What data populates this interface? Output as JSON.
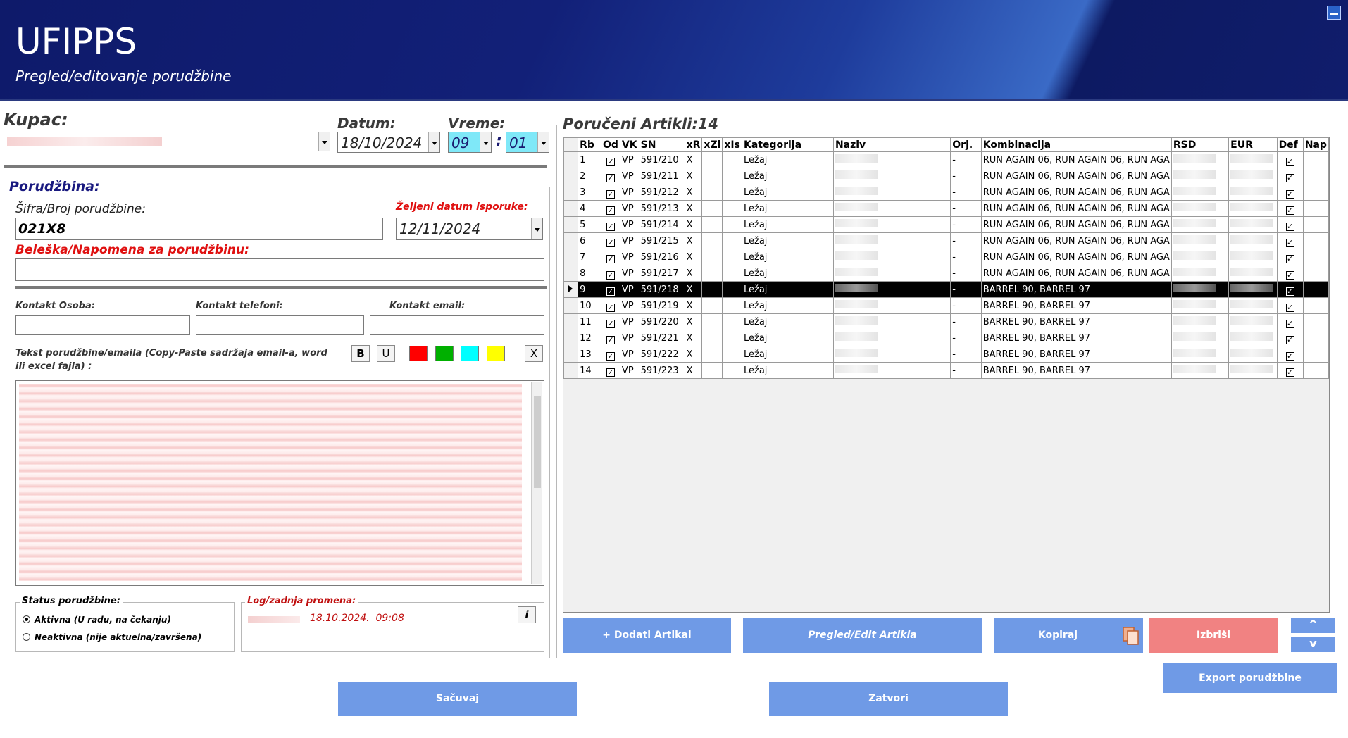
{
  "app": {
    "title": "UFIPPS",
    "subtitle": "Pregled/editovanje porudžbine"
  },
  "customer": {
    "label": "Kupac:"
  },
  "date": {
    "label": "Datum:",
    "value": "18/10/2024"
  },
  "time": {
    "label": "Vreme:",
    "hour": "09",
    "separator": ":",
    "minute": "01"
  },
  "order": {
    "section_label": "Porudžbina:",
    "number_label": "Šifra/Broj porudžbine:",
    "number_value": "021X8",
    "delivery_label": "Željeni datum isporuke:",
    "delivery_value": "12/11/2024",
    "note_label": "Beleška/Napomena za porudžbinu:"
  },
  "contact": {
    "person_label": "Kontakt Osoba:",
    "phones_label": "Kontakt telefoni:",
    "email_label": "Kontakt email:"
  },
  "email_text": {
    "label": "Tekst porudžbine/emaila (Copy-Paste sadržaja email-a, word ili excel fajla) :",
    "bold": "B",
    "underline": "U",
    "clear": "X",
    "colors": [
      "#ff0000",
      "#00b000",
      "#00ffff",
      "#ffff00"
    ]
  },
  "status": {
    "label": "Status porudžbine:",
    "active": "Aktivna (U radu, na čekanju)",
    "inactive": "Neaktivna (nije aktuelna/završena)",
    "selected": "active"
  },
  "log": {
    "label": "Log/zadnja promena:",
    "value": "18.10.2024.  09:08",
    "info_button": "i"
  },
  "articles": {
    "title": "Poručeni Artikli:14",
    "columns": [
      "Rb",
      "Od",
      "VK",
      "SN",
      "xR",
      "xZi",
      "xIs",
      "Kategorija",
      "Naziv",
      "Orj.",
      "Kombinacija",
      "RSD",
      "EUR",
      "Def",
      "Nap"
    ],
    "selected_row": 9,
    "rows": [
      {
        "rb": "1",
        "vk": "VP",
        "sn": "591/210",
        "xr": "X",
        "kat": "Ležaj",
        "orj": "-",
        "komb": "RUN AGAIN 06, RUN AGAIN 06, RUN AGA"
      },
      {
        "rb": "2",
        "vk": "VP",
        "sn": "591/211",
        "xr": "X",
        "kat": "Ležaj",
        "orj": "-",
        "komb": "RUN AGAIN 06, RUN AGAIN 06, RUN AGA"
      },
      {
        "rb": "3",
        "vk": "VP",
        "sn": "591/212",
        "xr": "X",
        "kat": "Ležaj",
        "orj": "-",
        "komb": "RUN AGAIN 06, RUN AGAIN 06, RUN AGA"
      },
      {
        "rb": "4",
        "vk": "VP",
        "sn": "591/213",
        "xr": "X",
        "kat": "Ležaj",
        "orj": "-",
        "komb": "RUN AGAIN 06, RUN AGAIN 06, RUN AGA"
      },
      {
        "rb": "5",
        "vk": "VP",
        "sn": "591/214",
        "xr": "X",
        "kat": "Ležaj",
        "orj": "-",
        "komb": "RUN AGAIN 06, RUN AGAIN 06, RUN AGA"
      },
      {
        "rb": "6",
        "vk": "VP",
        "sn": "591/215",
        "xr": "X",
        "kat": "Ležaj",
        "orj": "-",
        "komb": "RUN AGAIN 06, RUN AGAIN 06, RUN AGA"
      },
      {
        "rb": "7",
        "vk": "VP",
        "sn": "591/216",
        "xr": "X",
        "kat": "Ležaj",
        "orj": "-",
        "komb": "RUN AGAIN 06, RUN AGAIN 06, RUN AGA"
      },
      {
        "rb": "8",
        "vk": "VP",
        "sn": "591/217",
        "xr": "X",
        "kat": "Ležaj",
        "orj": "-",
        "komb": "RUN AGAIN 06, RUN AGAIN 06, RUN AGA"
      },
      {
        "rb": "9",
        "vk": "VP",
        "sn": "591/218",
        "xr": "X",
        "kat": "Ležaj",
        "orj": "-",
        "komb": "BARREL 90, BARREL 97"
      },
      {
        "rb": "10",
        "vk": "VP",
        "sn": "591/219",
        "xr": "X",
        "kat": "Ležaj",
        "orj": "-",
        "komb": "BARREL 90, BARREL 97"
      },
      {
        "rb": "11",
        "vk": "VP",
        "sn": "591/220",
        "xr": "X",
        "kat": "Ležaj",
        "orj": "-",
        "komb": "BARREL 90, BARREL 97"
      },
      {
        "rb": "12",
        "vk": "VP",
        "sn": "591/221",
        "xr": "X",
        "kat": "Ležaj",
        "orj": "-",
        "komb": "BARREL 90, BARREL 97"
      },
      {
        "rb": "13",
        "vk": "VP",
        "sn": "591/222",
        "xr": "X",
        "kat": "Ležaj",
        "orj": "-",
        "komb": "BARREL 90, BARREL 97"
      },
      {
        "rb": "14",
        "vk": "VP",
        "sn": "591/223",
        "xr": "X",
        "kat": "Ležaj",
        "orj": "-",
        "komb": "BARREL 90, BARREL 97"
      }
    ]
  },
  "buttons": {
    "add": "+ Dodati Artikal",
    "edit": "Pregled/Edit Artikla",
    "copy": "Kopiraj",
    "delete": "Izbriši",
    "up": "^",
    "down": "v",
    "export": "Export porudžbine",
    "save": "Sačuvaj",
    "close": "Zatvori"
  },
  "colors": {
    "button_blue": "#6f9ae6",
    "button_red": "#f18282",
    "header_dark": "#0e1a6a",
    "required_red": "#e01010"
  }
}
